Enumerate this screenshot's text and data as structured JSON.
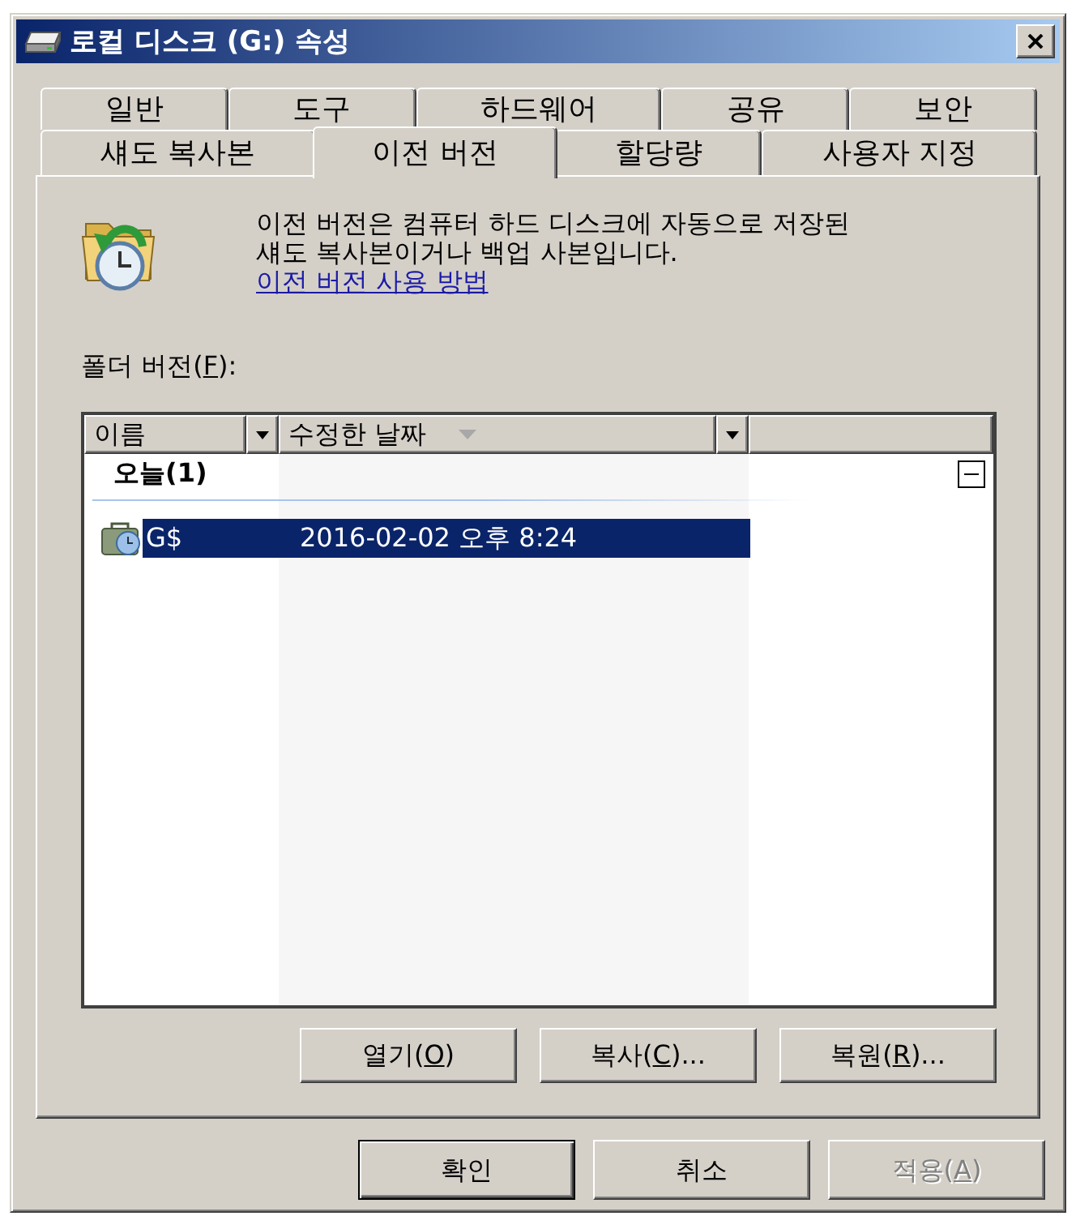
{
  "window": {
    "title": "로컬 디스크 (G:) 속성"
  },
  "tab_rows": [
    [
      {
        "label": "일반",
        "selected": false
      },
      {
        "label": "도구",
        "selected": false
      },
      {
        "label": "하드웨어",
        "selected": false
      },
      {
        "label": "공유",
        "selected": false
      },
      {
        "label": "보안",
        "selected": false
      }
    ],
    [
      {
        "label": "섀도 복사본",
        "selected": false
      },
      {
        "label": "이전 버전",
        "selected": true
      },
      {
        "label": "할당량",
        "selected": false
      },
      {
        "label": "사용자 지정",
        "selected": false
      }
    ]
  ],
  "description": {
    "text": "이전 버전은 컴퓨터 하드 디스크에 자동으로 저장된 섀도 복사본이거나 백업 사본입니다.",
    "link": "이전 버전 사용 방법"
  },
  "folder_versions": {
    "label": [
      {
        "text": "폴더 버전(",
        "underline": false
      },
      {
        "text": "F",
        "underline": true
      },
      {
        "text": "):",
        "underline": false
      }
    ],
    "columns": [
      {
        "label": "이름",
        "sorted": false
      },
      {
        "label": "수정한 날짜",
        "sorted": true
      }
    ],
    "groups": [
      {
        "label": "오늘(1)",
        "expanded": true,
        "items": [
          {
            "name": "G$",
            "modified": "2016-02-02 오후 8:24",
            "selected": true
          }
        ]
      }
    ]
  },
  "action_buttons": [
    {
      "label": [
        {
          "text": "열기(",
          "underline": false
        },
        {
          "text": "O",
          "underline": true
        },
        {
          "text": ")",
          "underline": false
        }
      ],
      "default": false,
      "disabled": false
    },
    {
      "label": [
        {
          "text": "복사(",
          "underline": false
        },
        {
          "text": "C",
          "underline": true
        },
        {
          "text": ")...",
          "underline": false
        }
      ],
      "default": false,
      "disabled": false
    },
    {
      "label": [
        {
          "text": "복원(",
          "underline": false
        },
        {
          "text": "R",
          "underline": true
        },
        {
          "text": ")...",
          "underline": false
        }
      ],
      "default": false,
      "disabled": false
    }
  ],
  "dialog_buttons": [
    {
      "label": [
        {
          "text": "확인",
          "underline": false
        }
      ],
      "default": true,
      "disabled": false
    },
    {
      "label": [
        {
          "text": "취소",
          "underline": false
        }
      ],
      "default": false,
      "disabled": false
    },
    {
      "label": [
        {
          "text": "적용(",
          "underline": false
        },
        {
          "text": "A",
          "underline": true
        },
        {
          "text": ")",
          "underline": false
        }
      ],
      "default": false,
      "disabled": true
    }
  ]
}
